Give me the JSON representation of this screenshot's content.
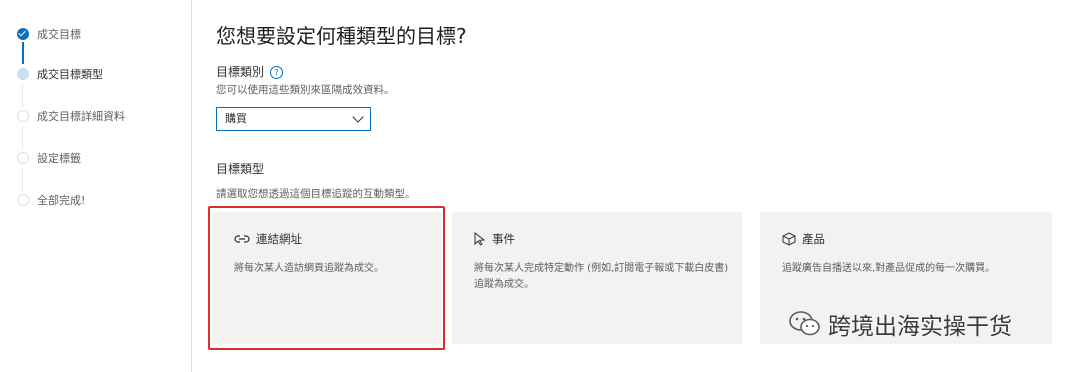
{
  "steps": [
    {
      "label": "成交目標",
      "state": "done"
    },
    {
      "label": "成交目標類型",
      "state": "current"
    },
    {
      "label": "成交目標詳細資料",
      "state": "todo"
    },
    {
      "label": "設定標籤",
      "state": "todo"
    },
    {
      "label": "全部完成!",
      "state": "todo"
    }
  ],
  "title": "您想要設定何種類型的目標?",
  "category": {
    "label": "目標類別",
    "help": "?",
    "hint": "您可以使用這些類別來區隔成效資料。",
    "value": "購買"
  },
  "type_section": {
    "label": "目標類型",
    "hint": "請選取您想透過這個目標追蹤的互動類型。"
  },
  "cards": [
    {
      "icon": "link-icon",
      "title": "連結網址",
      "desc": "將每次某人造訪網頁追蹤為成交。"
    },
    {
      "icon": "cursor-icon",
      "title": "事件",
      "desc": "將每次某人完成特定動作 (例如,訂閱電子報或下載白皮書) 追蹤為成交。"
    },
    {
      "icon": "box-icon",
      "title": "產品",
      "desc": "追蹤廣告自播送以來,對產品促成的每一次購買。"
    }
  ],
  "watermark": "跨境出海实操干货",
  "colors": {
    "accent": "#0f6cbd",
    "highlight": "#d9302c",
    "card": "#f3f2f1"
  }
}
